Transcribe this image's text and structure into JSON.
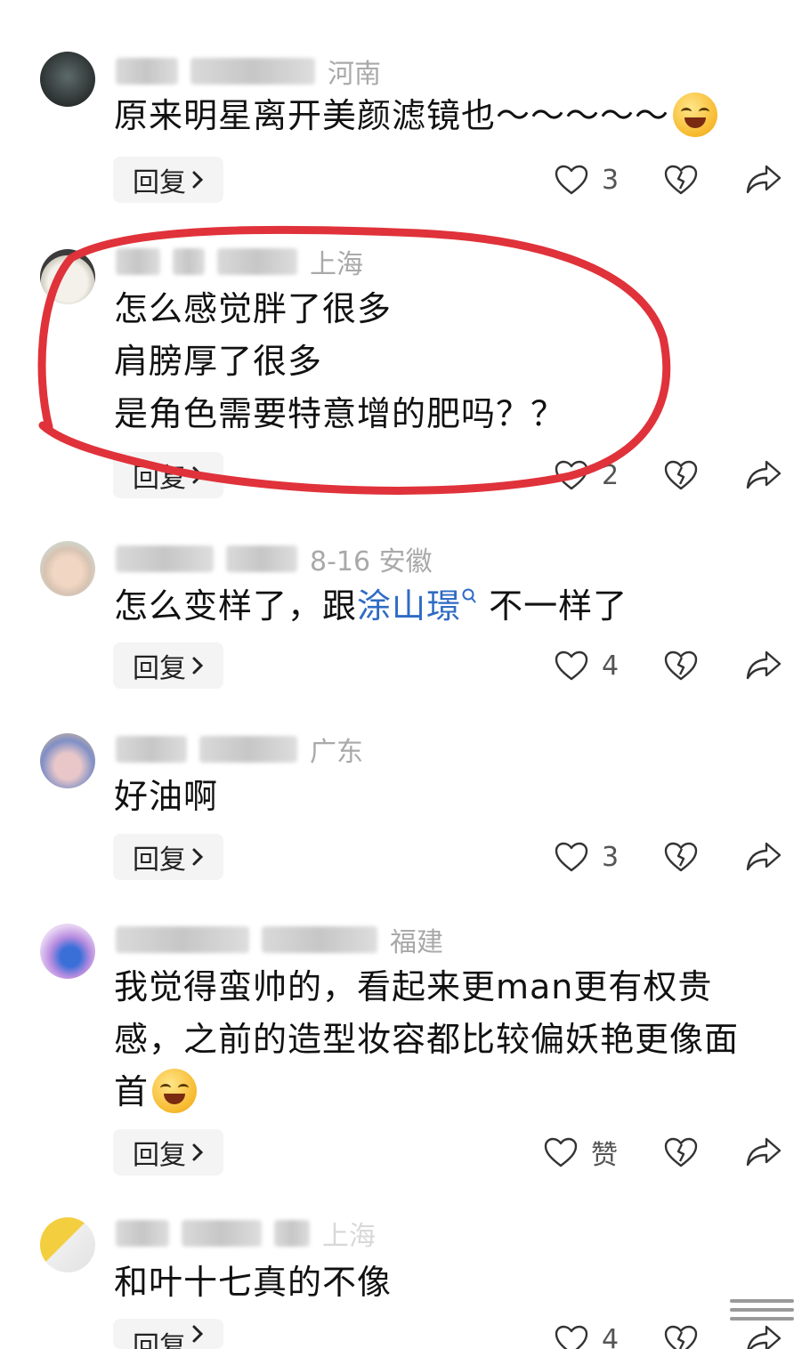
{
  "reply_label": "回复",
  "comments": [
    {
      "meta_suffix": "河南",
      "lines": [
        "原来明星离开美颜滤镜也～～～～～"
      ],
      "likes": "3"
    },
    {
      "meta_suffix": "上海",
      "lines": [
        "怎么感觉胖了很多",
        "肩膀厚了很多",
        "是角色需要特意增的肥吗？？"
      ],
      "likes": "2"
    },
    {
      "meta_suffix": "8-16  安徽",
      "line_before_link": "怎么变样了，跟",
      "link_text": "涂山璟",
      "line_after_link": " 不一样了",
      "likes": "4"
    },
    {
      "meta_suffix": "广东",
      "lines": [
        "好油啊"
      ],
      "likes": "3"
    },
    {
      "meta_suffix": "福建",
      "lines": [
        "我觉得蛮帅的，看起来更man更有权贵",
        "感，之前的造型妆容都比较偏妖艳更像面",
        "首"
      ],
      "likes": "赞"
    },
    {
      "meta_suffix": "上海",
      "lines": [
        "和叶十七真的不像"
      ],
      "likes": "4"
    }
  ],
  "colors": {
    "annotation_red": "#e0323a",
    "link_blue": "#2f6bc4",
    "reply_bg": "#f4f4f4"
  },
  "icons": [
    "heart-outline-icon",
    "broken-heart-icon",
    "share-arrow-icon",
    "chevron-right-icon",
    "search-mini-icon"
  ]
}
